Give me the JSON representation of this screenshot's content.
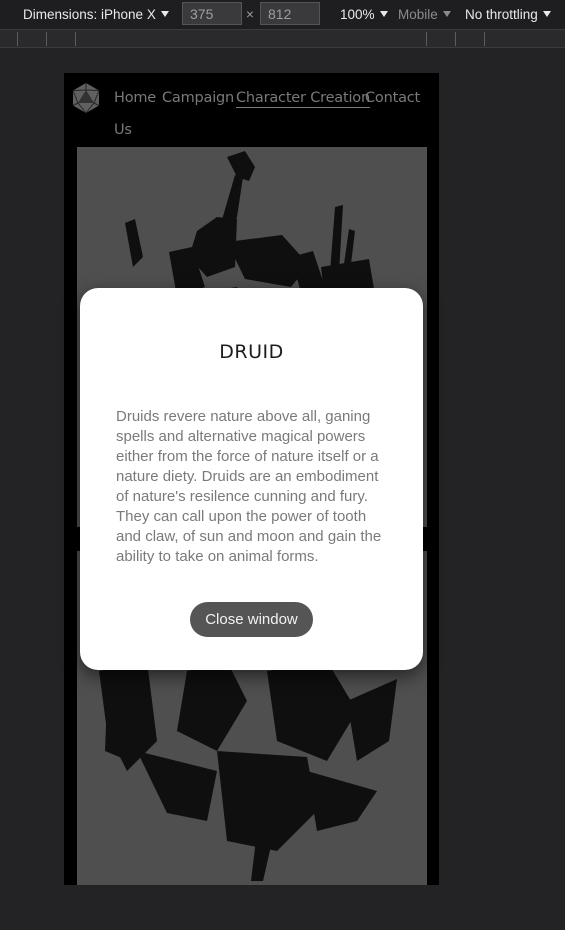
{
  "devtools": {
    "dimensions_label": "Dimensions: iPhone X",
    "width_value": "375",
    "times_symbol": "×",
    "height_value": "812",
    "zoom": "100%",
    "device_type": "Mobile",
    "throttling": "No throttling"
  },
  "site": {
    "nav": {
      "logo_icon": "d20-icon",
      "links": [
        "Home",
        "Campaign",
        "Character Creation",
        "Contact",
        "Us"
      ],
      "active": "Character Creation"
    }
  },
  "modal": {
    "title": "DRUID",
    "body_lines": [
      "Druids revere nature above all, ganing",
      "spells and alternative magical powers",
      "either from the force of nature itself or a",
      "nature diety. Druids are an embodiment",
      "of nature's resilence cunning and fury.",
      "They can call upon the power of tooth",
      "and claw, of sun and moon and gain the",
      "ability to take on animal forms."
    ],
    "close_label": "Close window"
  }
}
